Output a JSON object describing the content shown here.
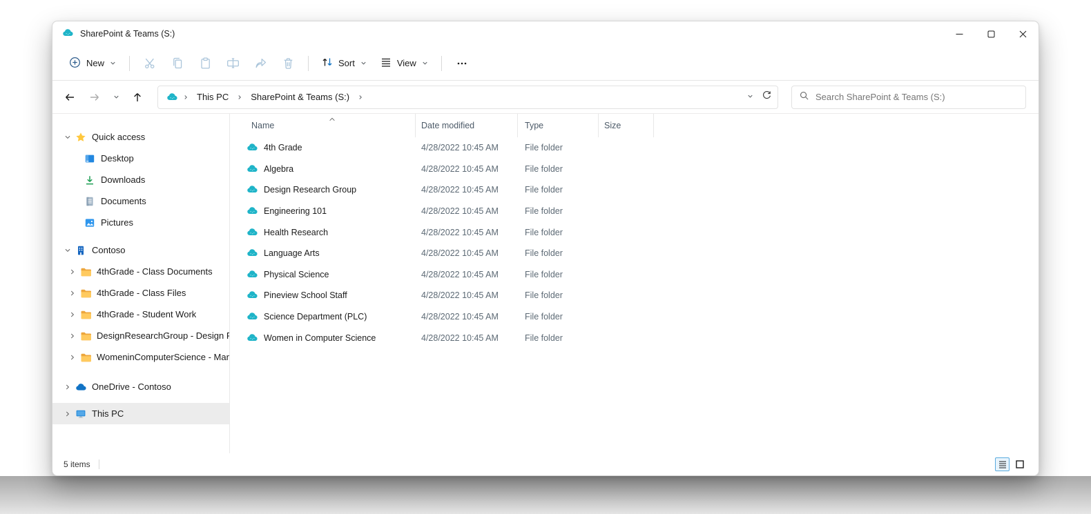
{
  "colors": {
    "accent_blue": "#0a6fc2",
    "drive_cloud_teal": "#1fb4c8",
    "onedrive_blue": "#1173c5",
    "folder_yellow": "#ffc94a",
    "disabled_icon_blue": "#a9c4da",
    "selected_row_gray": "#ececec"
  },
  "window": {
    "title": "SharePoint & Teams (S:)"
  },
  "toolbar": {
    "new_label": "New",
    "sort_label": "Sort",
    "view_label": "View",
    "disabled_actions": [
      "cut",
      "copy",
      "paste",
      "rename",
      "share",
      "delete"
    ]
  },
  "address_bar": {
    "breadcrumbs": [
      "This PC",
      "SharePoint & Teams (S:)"
    ]
  },
  "search": {
    "placeholder": "Search SharePoint & Teams (S:)"
  },
  "sidebar": {
    "items": [
      {
        "label": "Quick access",
        "icon": "star-icon",
        "expanded": true
      },
      {
        "label": "Desktop",
        "icon": "desktop-icon"
      },
      {
        "label": "Downloads",
        "icon": "downloads-icon"
      },
      {
        "label": "Documents",
        "icon": "documents-icon"
      },
      {
        "label": "Pictures",
        "icon": "pictures-icon"
      },
      {
        "label": "Contoso",
        "icon": "organization-icon",
        "expanded": true
      },
      {
        "label": "4thGrade - Class Documents",
        "icon": "folder-icon"
      },
      {
        "label": "4thGrade - Class Files",
        "icon": "folder-icon"
      },
      {
        "label": "4thGrade - Student Work",
        "icon": "folder-icon"
      },
      {
        "label": "DesignResearchGroup - Design Resea",
        "icon": "folder-icon"
      },
      {
        "label": "WomeninComputerScience - Manage",
        "icon": "folder-icon"
      },
      {
        "label": "OneDrive - Contoso",
        "icon": "onedrive-cloud-icon"
      },
      {
        "label": "This PC",
        "icon": "this-pc-icon",
        "selected": true
      }
    ]
  },
  "file_list": {
    "columns": {
      "name": "Name",
      "date": "Date modified",
      "type": "Type",
      "size": "Size"
    },
    "sort": {
      "column": "Name",
      "direction": "ascending"
    },
    "rows": [
      {
        "name": "4th Grade",
        "date": "4/28/2022 10:45 AM",
        "type": "File folder",
        "size": ""
      },
      {
        "name": "Algebra",
        "date": "4/28/2022 10:45 AM",
        "type": "File folder",
        "size": ""
      },
      {
        "name": "Design Research Group",
        "date": "4/28/2022 10:45 AM",
        "type": "File folder",
        "size": ""
      },
      {
        "name": "Engineering 101",
        "date": "4/28/2022 10:45 AM",
        "type": "File folder",
        "size": ""
      },
      {
        "name": "Health Research",
        "date": "4/28/2022 10:45 AM",
        "type": "File folder",
        "size": ""
      },
      {
        "name": "Language Arts",
        "date": "4/28/2022 10:45 AM",
        "type": "File folder",
        "size": ""
      },
      {
        "name": "Physical Science",
        "date": "4/28/2022 10:45 AM",
        "type": "File folder",
        "size": ""
      },
      {
        "name": "Pineview School Staff",
        "date": "4/28/2022 10:45 AM",
        "type": "File folder",
        "size": ""
      },
      {
        "name": "Science Department (PLC)",
        "date": "4/28/2022 10:45 AM",
        "type": "File folder",
        "size": ""
      },
      {
        "name": "Women in Computer Science",
        "date": "4/28/2022 10:45 AM",
        "type": "File folder",
        "size": ""
      }
    ]
  },
  "status_bar": {
    "items_count": "5 items"
  }
}
